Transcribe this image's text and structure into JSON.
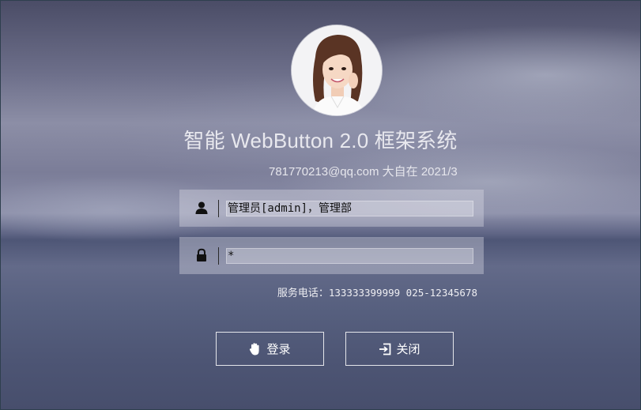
{
  "window": {
    "title": "智能 WebButton 2.0 框架系统",
    "subtitle": "781770213@qq.com 大自在 2021/3"
  },
  "login": {
    "username_value": "管理员[admin]，管理部",
    "password_value": "*",
    "user_icon": "user-icon",
    "lock_icon": "lock-icon"
  },
  "service": {
    "label": "服务电话：",
    "numbers": "133333399999 025-12345678"
  },
  "buttons": {
    "login_label": "登录",
    "login_icon": "hand-icon",
    "close_label": "关闭",
    "close_icon": "exit-icon"
  },
  "colors": {
    "text": "#e8e8ee",
    "field_bg": "rgba(220,222,232,0.38)",
    "button_border": "#ffffff"
  }
}
